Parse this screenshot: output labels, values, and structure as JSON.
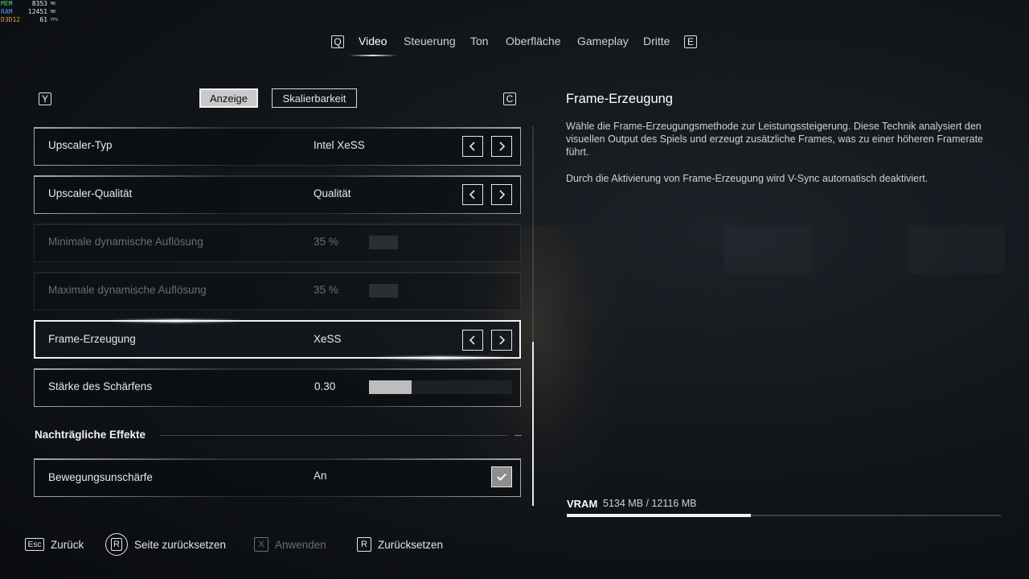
{
  "overlay": {
    "rows": [
      {
        "label": "MEM",
        "value": "8353",
        "unit": "MB",
        "color": "#4fd07a"
      },
      {
        "label": "RAM",
        "value": "12451",
        "unit": "MB",
        "color": "#4aa3e8"
      },
      {
        "label": "D3D12",
        "value": "61",
        "unit": "FPS",
        "color": "#e0a040"
      }
    ]
  },
  "nav": {
    "prev_key": "Q",
    "next_key": "E",
    "tabs": [
      "Video",
      "Steuerung",
      "Ton",
      "Oberfläche",
      "Gameplay",
      "Dritte"
    ],
    "active_tab": "Video"
  },
  "subnav": {
    "prev_key": "Y",
    "next_key": "C",
    "tabs": [
      "Anzeige",
      "Skalierbarkeit"
    ],
    "active": "Anzeige"
  },
  "settings": [
    {
      "label": "Upscaler-Typ",
      "value": "Intel XeSS",
      "control": "arrows"
    },
    {
      "label": "Upscaler-Qualität",
      "value": "Qualität",
      "control": "arrows"
    },
    {
      "label": "Minimale dynamische Auflösung",
      "value": "35 %",
      "control": "slider",
      "disabled": true
    },
    {
      "label": "Maximale dynamische Auflösung",
      "value": "35 %",
      "control": "slider",
      "disabled": true
    },
    {
      "label": "Frame-Erzeugung",
      "value": "XeSS",
      "control": "arrows",
      "selected": true
    },
    {
      "label": "Stärke des Schärfens",
      "value": "0.30",
      "control": "slider",
      "fill": 0.3
    }
  ],
  "section": {
    "title": "Nachträgliche Effekte"
  },
  "post_settings": [
    {
      "label": "Bewegungsunschärfe",
      "value": "An",
      "control": "checkbox",
      "checked": true
    }
  ],
  "info": {
    "title": "Frame-Erzeugung",
    "paragraph1": "Wähle die Frame-Erzeugungsmethode zur Leistungssteigerung. Diese Technik analysiert den visuellen Output des Spiels und erzeugt zusätzliche Frames, was zu einer höheren Framerate führt.",
    "paragraph2": "Durch die Aktivierung von Frame-Erzeugung wird V-Sync automatisch deaktiviert."
  },
  "vram": {
    "label": "VRAM",
    "value": "5134 MB / 12116 MB",
    "used_fraction": 0.424
  },
  "footer": {
    "back": {
      "key": "Esc",
      "label": "Zurück"
    },
    "reset_page": {
      "key": "R",
      "label": "Seite zurücksetzen"
    },
    "apply": {
      "key": "X",
      "label": "Anwenden"
    },
    "reset": {
      "key": "R",
      "label": "Zurücksetzen"
    }
  }
}
